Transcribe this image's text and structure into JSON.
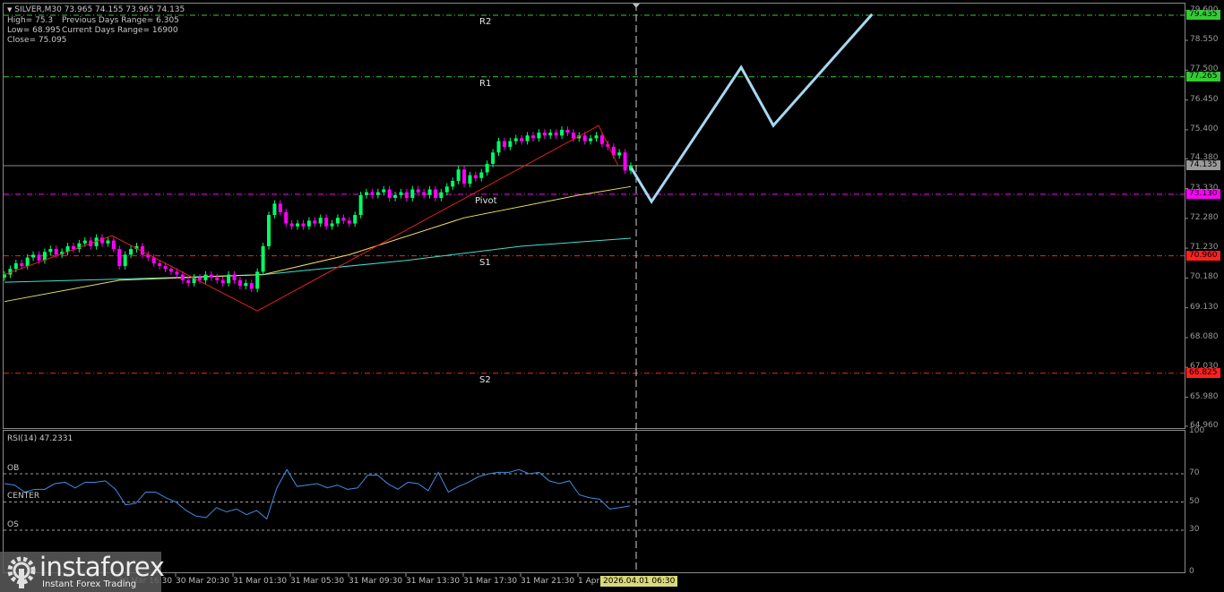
{
  "header": {
    "symbol_line": "SILVER,M30  73.965 74.155 73.965 74.135",
    "high": "High= 75.3",
    "prev_range": "Previous Days Range= 6.305",
    "low": "Low= 68.995",
    "cur_range": "Current Days Range= 16900",
    "close": "Close= 75.095"
  },
  "levels": [
    {
      "name": "R2",
      "label": "R2",
      "price": 79.435,
      "tag": "79.435",
      "color": "#33cc33"
    },
    {
      "name": "R1",
      "label": "R1",
      "price": 77.265,
      "tag": "77.265",
      "color": "#33cc33"
    },
    {
      "name": "Pivot",
      "label": "Pivot",
      "price": 73.13,
      "tag": "73.130",
      "color": "#ff00ff"
    },
    {
      "name": "S1",
      "label": "S1",
      "price": 70.96,
      "tag": "70.960",
      "color": "#ff2020"
    },
    {
      "name": "S2",
      "label": "S2",
      "price": 66.825,
      "tag": "66.825",
      "color": "#ff2020"
    }
  ],
  "current_price": {
    "price": 74.135,
    "tag": "74.135",
    "color": "#9a9a9a"
  },
  "price_axis": [
    "79.600",
    "78.550",
    "77.500",
    "76.450",
    "75.400",
    "74.380",
    "73.330",
    "72.280",
    "71.230",
    "70.180",
    "69.130",
    "68.080",
    "67.030",
    "65.980",
    "64.960"
  ],
  "chart_data": {
    "type": "candlestick",
    "closes": [
      70.3,
      70.5,
      70.7,
      70.6,
      70.9,
      71.0,
      70.8,
      71.1,
      71.2,
      71.0,
      71.1,
      71.3,
      71.2,
      71.4,
      71.5,
      71.3,
      71.6,
      71.4,
      71.5,
      71.2,
      70.6,
      71.0,
      71.2,
      71.3,
      71.0,
      70.9,
      70.7,
      70.6,
      70.5,
      70.4,
      70.3,
      70.1,
      70.0,
      70.2,
      70.1,
      70.3,
      70.2,
      70.1,
      70.0,
      70.3,
      70.1,
      69.9,
      70.0,
      69.8,
      70.4,
      71.3,
      72.4,
      72.8,
      72.5,
      72.1,
      72.0,
      72.1,
      72.0,
      72.2,
      72.1,
      72.3,
      72.0,
      72.1,
      72.3,
      72.2,
      72.1,
      72.4,
      73.1,
      73.2,
      73.1,
      73.2,
      73.3,
      73.0,
      73.1,
      73.2,
      73.0,
      73.3,
      73.2,
      73.1,
      73.3,
      73.0,
      73.2,
      73.4,
      73.6,
      74.0,
      73.5,
      73.8,
      73.7,
      73.9,
      74.2,
      74.6,
      75.0,
      74.8,
      75.0,
      75.1,
      75.0,
      75.2,
      75.1,
      75.3,
      75.2,
      75.3,
      75.2,
      75.4,
      75.3,
      75.1,
      75.2,
      75.0,
      75.1,
      75.2,
      74.9,
      74.8,
      74.5,
      74.6,
      73.965,
      74.135
    ],
    "ma_fast": [
      [
        0,
        69.35
      ],
      [
        20,
        70.1
      ],
      [
        45,
        70.3
      ],
      [
        60,
        71.0
      ],
      [
        80,
        72.3
      ],
      [
        100,
        73.1
      ],
      [
        109,
        73.4
      ]
    ],
    "ma_slow": [
      [
        0,
        70.03
      ],
      [
        30,
        70.2
      ],
      [
        45,
        70.3
      ],
      [
        70,
        70.8
      ],
      [
        90,
        71.3
      ],
      [
        109,
        71.58
      ]
    ],
    "zigzag": [
      [
        0,
        70.3
      ],
      [
        18.7,
        71.67
      ],
      [
        44,
        69.02
      ],
      [
        103.4,
        75.55
      ],
      [
        106.8,
        74.13
      ]
    ],
    "forecast": [
      [
        109.1,
        74.05
      ],
      [
        112.6,
        72.87
      ],
      [
        128.2,
        77.6
      ],
      [
        133.8,
        75.55
      ],
      [
        151,
        79.47
      ]
    ],
    "bull_color": "#00ff66",
    "bear_color": "#ff00ff",
    "forecast_color": "#a8d8f0",
    "ylim": [
      64.96,
      79.6
    ]
  },
  "rsi": {
    "title": "RSI(14) 47.2331",
    "ob_label": "OB",
    "center_label": "CENTER",
    "os_label": "OS",
    "axis": [
      "100",
      "70",
      "50",
      "30",
      "0"
    ],
    "values": [
      63,
      62,
      57,
      59,
      59,
      63,
      64,
      60,
      64,
      64,
      65,
      59,
      48,
      49,
      57,
      57,
      53,
      50,
      44,
      40,
      39,
      46,
      43,
      45,
      41,
      44,
      38,
      60,
      73,
      61,
      62,
      63,
      60,
      62,
      59,
      60,
      69,
      69,
      63,
      59,
      64,
      63,
      58,
      71,
      57,
      61,
      64,
      68,
      70,
      71,
      71,
      73,
      70,
      71,
      65,
      63,
      65,
      55,
      53,
      52,
      45,
      46,
      47.2
    ],
    "color": "#3d8ee6"
  },
  "time_axis": [
    {
      "label": "30 Mar 16:30",
      "partial": true
    },
    {
      "label": "30 Mar 20:30"
    },
    {
      "label": "31 Mar 01:30"
    },
    {
      "label": "31 Mar 05:30"
    },
    {
      "label": "31 Mar 09:30"
    },
    {
      "label": "31 Mar 13:30"
    },
    {
      "label": "31 Mar 17:30"
    },
    {
      "label": "31 Mar 21:30"
    },
    {
      "label": "1 Apr"
    }
  ],
  "time_cursor": "2026.04.01 06:30",
  "logo": {
    "name": "instaforex",
    "tagline": "Instant Forex Trading"
  }
}
